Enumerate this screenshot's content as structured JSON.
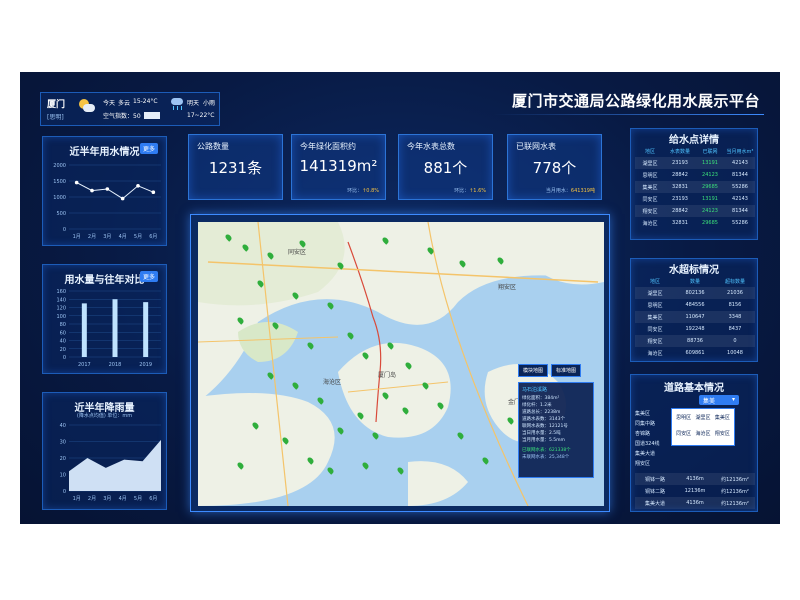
{
  "title": "厦门市交通局公路绿化用水展示平台",
  "weather": {
    "city": "厦门",
    "city_sub": "[思明]",
    "today_label": "今天",
    "today_desc": "多云",
    "today_temp": "15-24°C",
    "aqi_label": "空气指数：50",
    "tomorrow_label": "明天",
    "tomorrow_desc": "小雨",
    "tomorrow_temp": "17~22°C",
    "icon_today": "partly-cloudy-icon",
    "icon_tomorrow": "rain-icon"
  },
  "more_label": "更多",
  "water_usage": {
    "title": "近半年用水情况",
    "y_ticks": [
      "2000",
      "1500",
      "1000",
      "500",
      "0"
    ],
    "chart_data": {
      "type": "line",
      "categories": [
        "1月",
        "2月",
        "3月",
        "4月",
        "5月",
        "6月"
      ],
      "values": [
        1450,
        1200,
        1250,
        950,
        1350,
        1150
      ],
      "ylim": [
        0,
        2000
      ]
    }
  },
  "compare": {
    "title": "用水量与往年对比",
    "y_ticks": [
      "160",
      "140",
      "120",
      "100",
      "80",
      "60",
      "40",
      "20",
      "0"
    ],
    "chart_data": {
      "type": "bar",
      "categories": [
        "2017",
        "2018",
        "2019"
      ],
      "values": [
        130,
        140,
        133
      ],
      "ylim": [
        0,
        160
      ]
    }
  },
  "rainfall": {
    "title": "近半年降雨量",
    "subtitle": "(降水点均值) 单位：mm",
    "y_ticks": [
      "40",
      "30",
      "20",
      "10",
      "0"
    ],
    "chart_data": {
      "type": "area",
      "categories": [
        "1月",
        "2月",
        "3月",
        "4月",
        "5月",
        "6月"
      ],
      "values": [
        12,
        20,
        14,
        19,
        18,
        31
      ],
      "ylim": [
        0,
        40
      ]
    }
  },
  "stats": [
    {
      "label": "公路数量",
      "value": "1231条",
      "sub_label": "",
      "sub_dir": "",
      "sub_value": ""
    },
    {
      "label": "今年绿化面积约",
      "value": "141319m²",
      "sub_label": "环比：",
      "sub_dir": "↑",
      "sub_value": "0.8%"
    },
    {
      "label": "今年水表总数",
      "value": "881个",
      "sub_label": "环比：",
      "sub_dir": "↑",
      "sub_value": "1.6%"
    },
    {
      "label": "已联网水表",
      "value": "778个",
      "sub_label": "当月用水：",
      "sub_dir": "",
      "sub_value": "641319吨"
    }
  ],
  "map": {
    "places": [
      "海沧区",
      "厦门岛",
      "金门县",
      "翔安区",
      "同安区"
    ],
    "btn1": "模块地图",
    "btn2": "标准地图",
    "popup": {
      "title": "马石泊溪路",
      "lines": [
        "绿化面积：384m²",
        "绿化杆：1.2米",
        "道路总长：2238m",
        "道路水表数：3143个",
        "联网水表数：12121号",
        "当日用水量：2.5吨",
        "当月用水量：5.5mm"
      ],
      "footer1": "已联网水表：621338个",
      "footer2": "未联网水表：25,348个"
    }
  },
  "supply": {
    "title": "给水点详情",
    "headers": [
      "地区",
      "水表数量",
      "已联网",
      "当月用水m³"
    ],
    "rows": [
      [
        "湖里区",
        "23193",
        "13191",
        "42143"
      ],
      [
        "思明区",
        "28842",
        "24123",
        "81344"
      ],
      [
        "集美区",
        "32831",
        "29685",
        "55286"
      ],
      [
        "同安区",
        "23193",
        "13191",
        "42143"
      ],
      [
        "翔安区",
        "28842",
        "24123",
        "81344"
      ],
      [
        "海沧区",
        "32831",
        "29685",
        "55286"
      ]
    ]
  },
  "overuse": {
    "title": "水超标情况",
    "headers": [
      "地区",
      "数量",
      "超标数量"
    ],
    "rows": [
      [
        "湖里区",
        "802136",
        "21036"
      ],
      [
        "思明区",
        "484556",
        "8156"
      ],
      [
        "集美区",
        "110647",
        "3348"
      ],
      [
        "同安区",
        "192248",
        "8437"
      ],
      [
        "翔安区",
        "88736",
        "0"
      ],
      [
        "海沧区",
        "609861",
        "10048"
      ]
    ]
  },
  "roads": {
    "title": "道路基本情况",
    "dropdown_value": "集美",
    "options": [
      "思明区",
      "湖里区",
      "集美区",
      "同安区",
      "海沧区",
      "翔安区"
    ],
    "row_labels": [
      "集美区",
      "同集中路",
      "杏锦路",
      "国道324线",
      "集美大道",
      "翔安区",
      "厦门",
      "铜钵一路",
      "铜钵二路",
      "集美大道"
    ],
    "rows": [
      [
        "铜钵一路",
        "4136m",
        "约12136m²"
      ],
      [
        "铜钵二路",
        "12136m",
        "约12136m²"
      ],
      [
        "集美大道",
        "4136m",
        "约12136m²"
      ]
    ]
  }
}
